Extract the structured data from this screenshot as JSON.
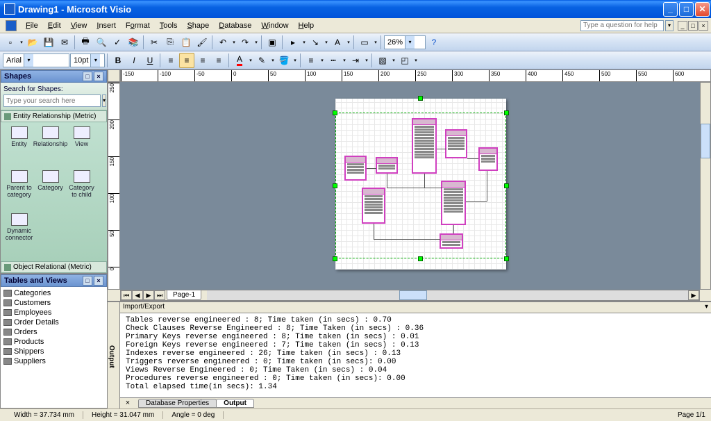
{
  "titlebar": {
    "title": "Drawing1 - Microsoft Visio"
  },
  "menu": {
    "file": "File",
    "edit": "Edit",
    "view": "View",
    "insert": "Insert",
    "format": "Format",
    "tools": "Tools",
    "shape": "Shape",
    "data": "Database",
    "window": "Window",
    "help": "Help"
  },
  "help_search_placeholder": "Type a question for help",
  "formatting": {
    "font": "Arial",
    "size": "10pt",
    "zoom": "26%"
  },
  "shapes_pane": {
    "title": "Shapes",
    "search_label": "Search for Shapes:",
    "search_placeholder": "Type your search here",
    "stencils": [
      {
        "name": "Entity Relationship (Metric)"
      },
      {
        "name": "Object Relational (Metric)"
      }
    ],
    "shapes": [
      "Entity",
      "Relationship",
      "View",
      "Parent to category",
      "Category",
      "Category to child",
      "Dynamic connector"
    ]
  },
  "tables_pane": {
    "title": "Tables and Views",
    "items": [
      "Categories",
      "Customers",
      "Employees",
      "Order Details",
      "Orders",
      "Products",
      "Shippers",
      "Suppliers"
    ]
  },
  "page_tab": "Page-1",
  "output": {
    "header": "Import/Export",
    "lines": [
      "Tables reverse engineered : 8; Time taken (in secs) : 0.70",
      "Check Clauses Reverse Engineered : 8; Time Taken (in secs) : 0.36",
      "Primary Keys reverse engineered : 8; Time taken (in secs) : 0.01",
      "Foreign Keys reverse engineered : 7; Time taken (in secs) : 0.13",
      "Indexes reverse engineered : 26; Time taken (in secs) : 0.13",
      "Triggers reverse engineered : 0; Time taken (in secs): 0.00",
      "Views Reverse Engineered : 0; Time Taken (in secs) : 0.04",
      "Procedures reverse engineered : 0; Time taken (in secs): 0.00",
      "Total elapsed time(in secs): 1.34"
    ],
    "tabs": [
      "Database Properties",
      "Output"
    ],
    "vlabel": "Output"
  },
  "ruler_h": [
    -150,
    -100,
    -50,
    0,
    50,
    100,
    150,
    200,
    250,
    300,
    350,
    400,
    450,
    500,
    550,
    600
  ],
  "ruler_v": [
    250,
    200,
    150,
    100,
    50,
    0
  ],
  "status": {
    "width": "Width = 37.734 mm",
    "height": "Height = 31.047 mm",
    "angle": "Angle = 0 deg",
    "page": "Page 1/1"
  }
}
